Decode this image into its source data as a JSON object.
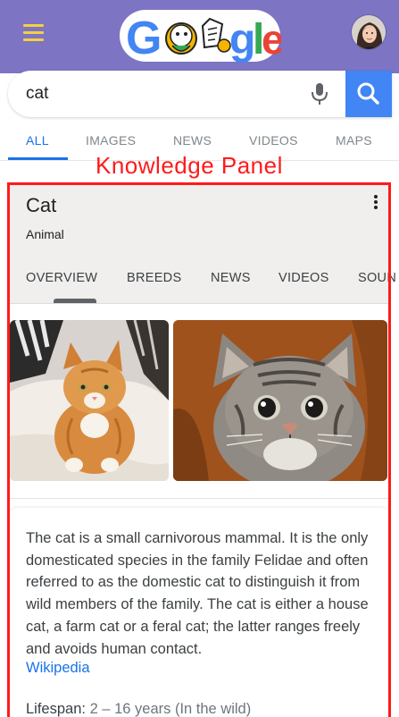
{
  "header": {
    "logo_text": "Google",
    "colors": {
      "header_bg": "#7d74c4",
      "menu": "#f4d03f"
    }
  },
  "search": {
    "query": "cat",
    "placeholder": "Search"
  },
  "tabs": [
    {
      "label": "ALL",
      "active": true
    },
    {
      "label": "IMAGES"
    },
    {
      "label": "NEWS"
    },
    {
      "label": "VIDEOS"
    },
    {
      "label": "MAPS"
    }
  ],
  "annotation": {
    "label": "Knowledge Panel",
    "color": "#ff1a1a"
  },
  "knowledge_panel": {
    "title": "Cat",
    "subtitle": "Animal",
    "tabs": [
      {
        "label": "OVERVIEW",
        "active": true
      },
      {
        "label": "BREEDS"
      },
      {
        "label": "NEWS"
      },
      {
        "label": "VIDEOS"
      },
      {
        "label": "SOUN"
      }
    ],
    "description": "The cat is a small carnivorous mammal. It is the only domesticated species in the family Felidae and often referred to as the domestic cat to distinguish it from wild members of the family. The cat is either a house cat, a farm cat or a feral cat; the latter ranges freely and avoids human contact.",
    "source_link": "Wikipedia",
    "lifespan_label": "Lifespan:",
    "lifespan_value": "2 – 16 years (In the wild)"
  }
}
